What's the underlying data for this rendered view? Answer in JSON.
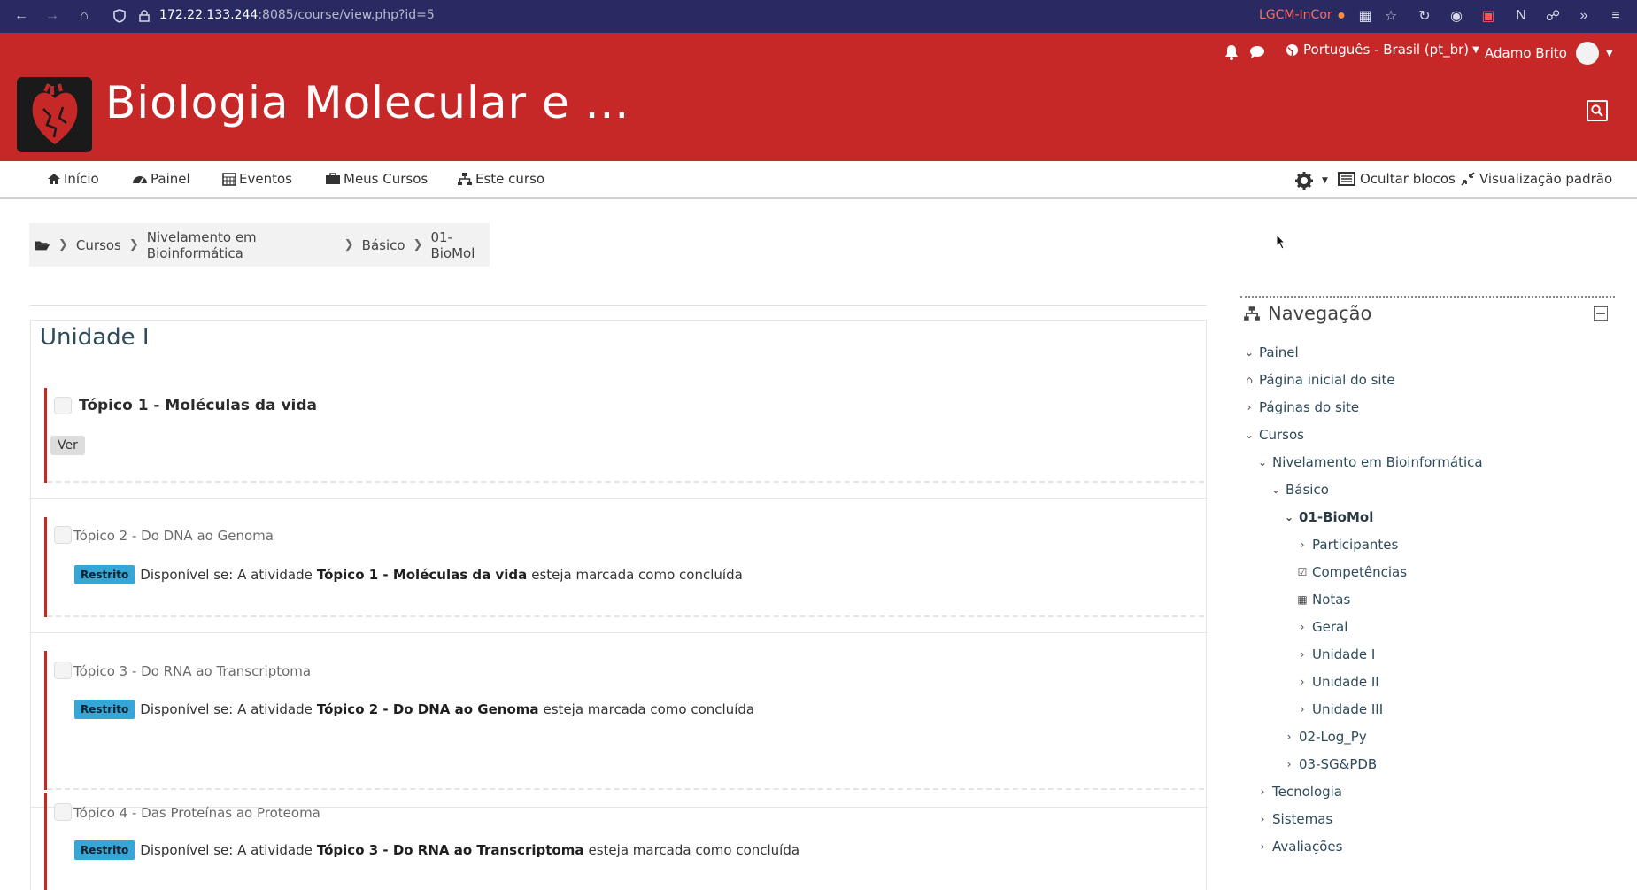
{
  "browser": {
    "url_host": "172.22.133.244",
    "url_rest": ":8085/course/view.php?id=5",
    "ext_label": "LGCM-InCor"
  },
  "header": {
    "site_title": "Biologia Molecular e ...",
    "language": "Português - Brasil (pt_br)",
    "user_name": "Adamo Brito"
  },
  "navbar": {
    "items": [
      {
        "label": "Início"
      },
      {
        "label": "Painel"
      },
      {
        "label": "Eventos"
      },
      {
        "label": "Meus Cursos"
      },
      {
        "label": "Este curso"
      }
    ],
    "hide_blocks": "Ocultar blocos",
    "default_view": "Visualização padrão"
  },
  "breadcrumb": [
    "Cursos",
    "Nivelamento em Bioinformática",
    "Básico",
    "01-BioMol"
  ],
  "main": {
    "section_title": "Unidade I",
    "activities": [
      {
        "title": "Tópico 1 - Moléculas da vida",
        "button": "Ver"
      },
      {
        "title": "Tópico 2 - Do DNA ao Genoma",
        "badge": "Restrito",
        "pre": "Disponível se: A atividade",
        "bold": "Tópico 1 - Moléculas da vida",
        "post": "esteja marcada como concluída"
      },
      {
        "title": "Tópico 3 - Do RNA ao Transcriptoma",
        "badge": "Restrito",
        "pre": "Disponível se: A atividade",
        "bold": "Tópico 2 - Do DNA ao Genoma",
        "post": "esteja marcada como concluída"
      },
      {
        "title": "Tópico 4 - Das Proteínas ao Proteoma",
        "badge": "Restrito",
        "pre": "Disponível se: A atividade",
        "bold": "Tópico 3 - Do RNA ao Transcriptoma",
        "post": "esteja marcada como concluída"
      }
    ]
  },
  "navigation": {
    "title": "Navegação",
    "items": [
      {
        "label": "Painel"
      },
      {
        "label": "Página inicial do site"
      },
      {
        "label": "Páginas do site"
      },
      {
        "label": "Cursos"
      },
      {
        "label": "Nivelamento em Bioinformática"
      },
      {
        "label": "Básico"
      },
      {
        "label": "01-BioMol"
      },
      {
        "label": "Participantes"
      },
      {
        "label": "Competências"
      },
      {
        "label": "Notas"
      },
      {
        "label": "Geral"
      },
      {
        "label": "Unidade I"
      },
      {
        "label": "Unidade II"
      },
      {
        "label": "Unidade III"
      },
      {
        "label": "02-Log_Py"
      },
      {
        "label": "03-SG&PDB"
      },
      {
        "label": "Tecnologia"
      },
      {
        "label": "Sistemas"
      },
      {
        "label": "Avaliações"
      }
    ]
  }
}
